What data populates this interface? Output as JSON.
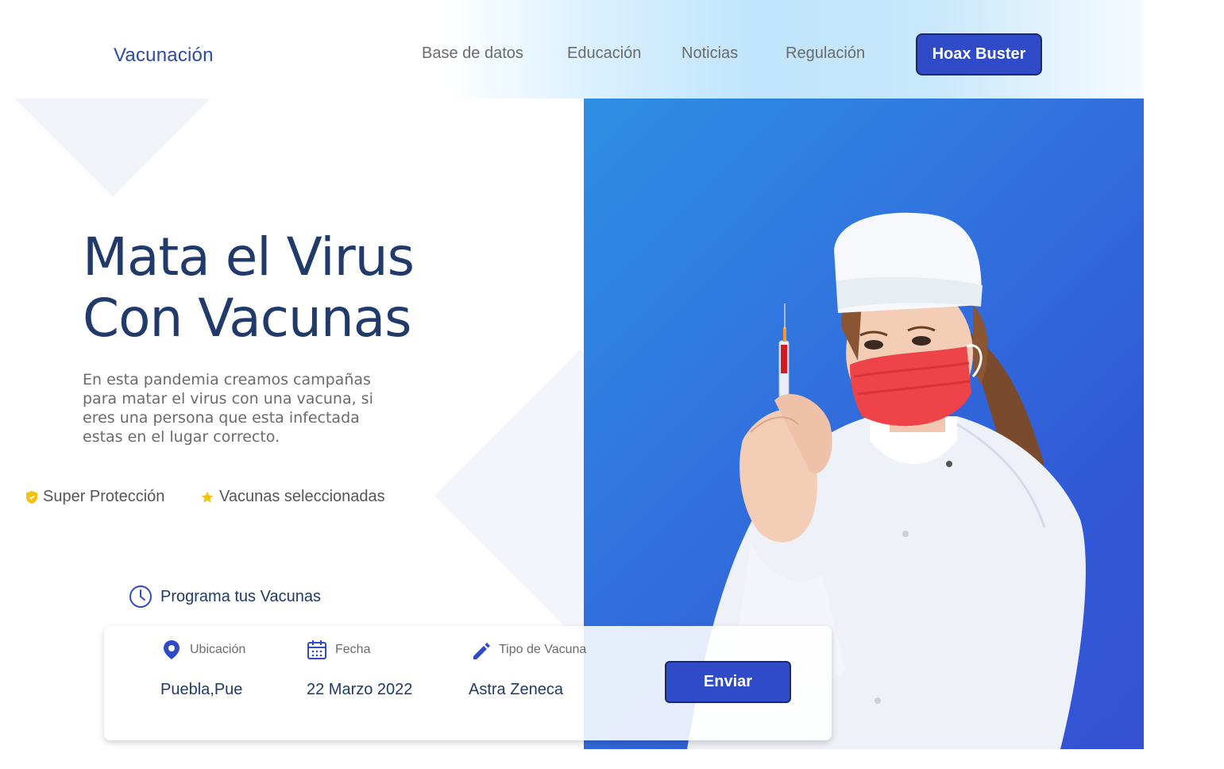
{
  "brand": {
    "name": "Vacunación"
  },
  "nav": {
    "items": [
      "Base de datos",
      "Educación",
      "Noticias",
      "Regulación"
    ],
    "cta": "Hoax Buster"
  },
  "hero": {
    "title_line1": "Mata el Virus",
    "title_line2": "Con Vacunas",
    "description": "En esta pandemia creamos campañas para matar el virus con una vacuna, si eres una persona que esta infectada estas en el lugar correcto.",
    "features": [
      "Super Protección",
      "Vacunas seleccionadas"
    ]
  },
  "schedule": {
    "heading": "Programa tus Vacunas",
    "fields": [
      {
        "label": "Ubicación",
        "value": "Puebla,Pue",
        "icon": "location-pin-icon"
      },
      {
        "label": "Fecha",
        "value": "22 Marzo 2022",
        "icon": "calendar-icon"
      },
      {
        "label": "Tipo de Vacuna",
        "value": "Astra Zeneca",
        "icon": "pencil-icon"
      }
    ],
    "submit": "Enviar"
  },
  "colors": {
    "primary": "#2f4bc7",
    "heading": "#1f3a6b",
    "accent_yellow": "#f4c20d"
  }
}
